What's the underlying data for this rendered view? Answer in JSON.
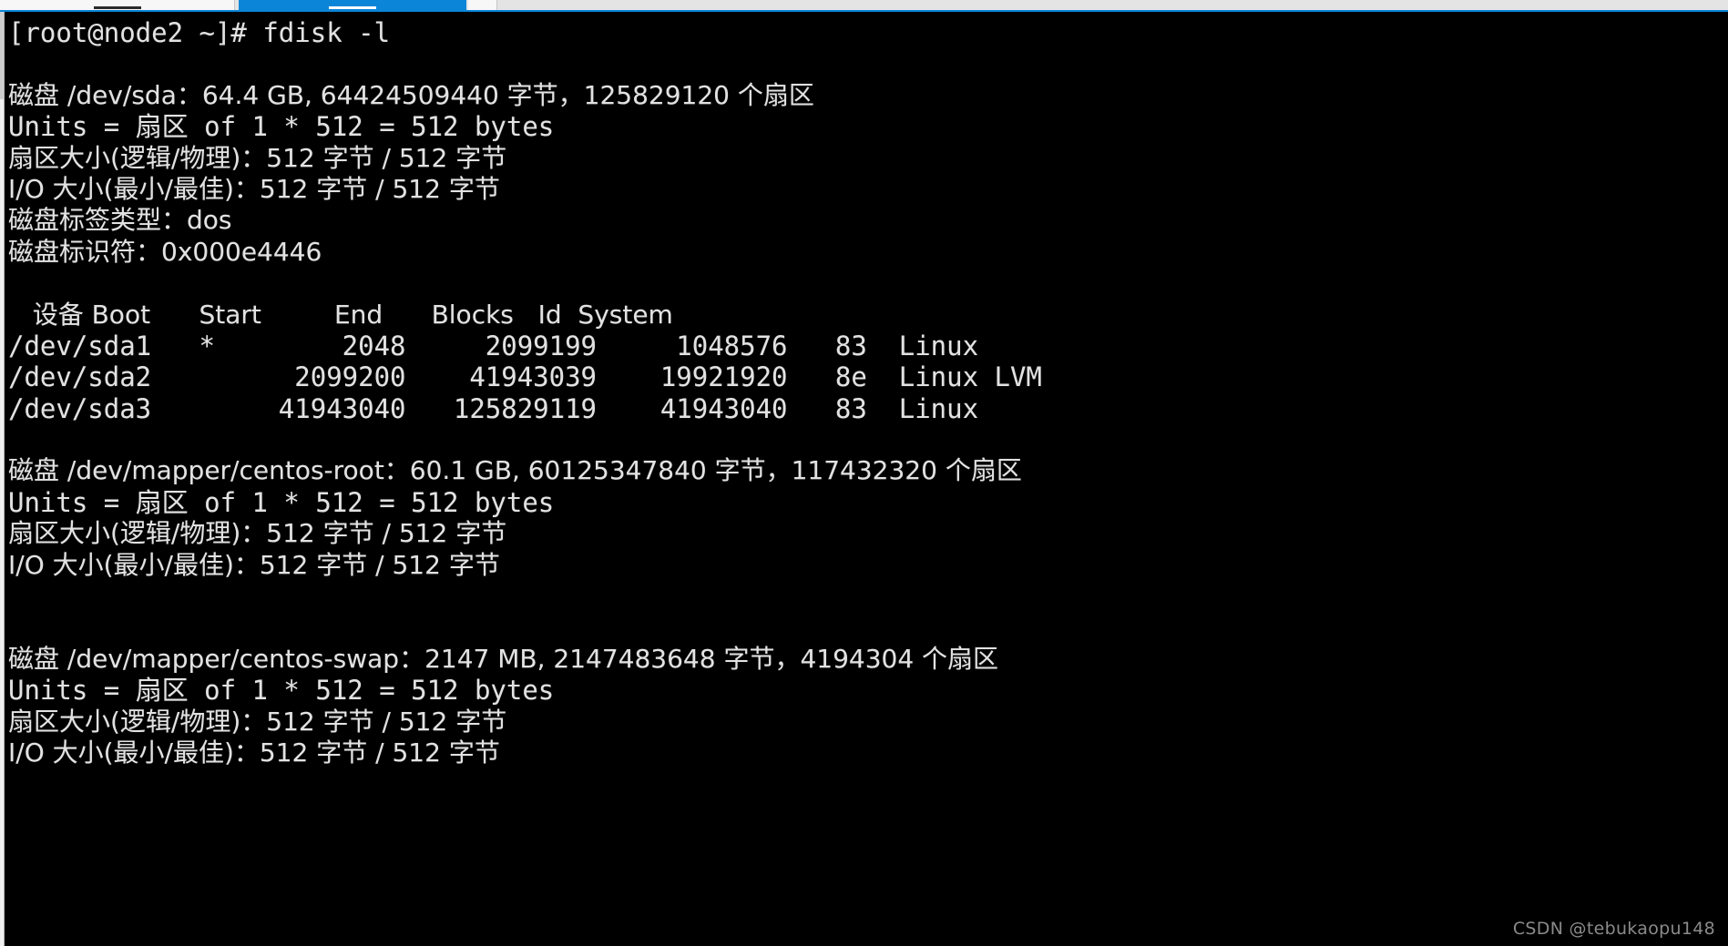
{
  "window": {
    "tabs": [
      {
        "name": "tab-left-inactive",
        "state": "inactive",
        "label": ""
      },
      {
        "name": "tab-active-session",
        "state": "active",
        "label": ""
      },
      {
        "name": "tab-right-inactive",
        "state": "inactive",
        "label": ""
      }
    ],
    "accent_color": "#0a85d8",
    "tabstrip_bg": "#e4e4e4",
    "terminal_bg": "#000000",
    "terminal_fg": "#e2e2e2"
  },
  "terminal": {
    "prompt": "[root@node2 ~]# ",
    "command": "fdisk -l",
    "lines": [
      "[root@node2 ~]# fdisk -l",
      "",
      "磁盘 /dev/sda：64.4 GB, 64424509440 字节，125829120 个扇区",
      "Units = 扇区 of 1 * 512 = 512 bytes",
      "扇区大小(逻辑/物理)：512 字节 / 512 字节",
      "I/O 大小(最小/最佳)：512 字节 / 512 字节",
      "磁盘标签类型：dos",
      "磁盘标识符：0x000e4446",
      "",
      "   设备 Boot      Start         End      Blocks   Id  System",
      "/dev/sda1   *        2048     2099199     1048576   83  Linux",
      "/dev/sda2         2099200    41943039    19921920   8e  Linux LVM",
      "/dev/sda3        41943040   125829119    41943040   83  Linux",
      "",
      "磁盘 /dev/mapper/centos-root：60.1 GB, 60125347840 字节，117432320 个扇区",
      "Units = 扇区 of 1 * 512 = 512 bytes",
      "扇区大小(逻辑/物理)：512 字节 / 512 字节",
      "I/O 大小(最小/最佳)：512 字节 / 512 字节",
      "",
      "",
      "磁盘 /dev/mapper/centos-swap：2147 MB, 2147483648 字节，4194304 个扇区",
      "Units = 扇区 of 1 * 512 = 512 bytes",
      "扇区大小(逻辑/物理)：512 字节 / 512 字节",
      "I/O 大小(最小/最佳)：512 字节 / 512 字节"
    ],
    "disks": [
      {
        "device": "/dev/sda",
        "size_human": "64.4 GB",
        "size_bytes": "64424509440",
        "sectors": "125829120",
        "units": "Units = 扇区 of 1 * 512 = 512 bytes",
        "sector_size": "扇区大小(逻辑/物理)：512 字节 / 512 字节",
        "io_size": "I/O 大小(最小/最佳)：512 字节 / 512 字节",
        "label_type": "dos",
        "identifier": "0x000e4446"
      },
      {
        "device": "/dev/mapper/centos-root",
        "size_human": "60.1 GB",
        "size_bytes": "60125347840",
        "sectors": "117432320",
        "units": "Units = 扇区 of 1 * 512 = 512 bytes",
        "sector_size": "扇区大小(逻辑/物理)：512 字节 / 512 字节",
        "io_size": "I/O 大小(最小/最佳)：512 字节 / 512 字节"
      },
      {
        "device": "/dev/mapper/centos-swap",
        "size_human": "2147 MB",
        "size_bytes": "2147483648",
        "sectors": "4194304",
        "units": "Units = 扇区 of 1 * 512 = 512 bytes",
        "sector_size": "扇区大小(逻辑/物理)：512 字节 / 512 字节",
        "io_size": "I/O 大小(最小/最佳)：512 字节 / 512 字节"
      }
    ],
    "partition_table": {
      "headers": [
        "设备",
        "Boot",
        "Start",
        "End",
        "Blocks",
        "Id",
        "System"
      ],
      "rows": [
        {
          "device": "/dev/sda1",
          "boot": "*",
          "start": "2048",
          "end": "2099199",
          "blocks": "1048576",
          "id": "83",
          "system": "Linux"
        },
        {
          "device": "/dev/sda2",
          "boot": "",
          "start": "2099200",
          "end": "41943039",
          "blocks": "19921920",
          "id": "8e",
          "system": "Linux LVM"
        },
        {
          "device": "/dev/sda3",
          "boot": "",
          "start": "41943040",
          "end": "125829119",
          "blocks": "41943040",
          "id": "83",
          "system": "Linux"
        }
      ]
    }
  },
  "watermark": {
    "text": "CSDN @tebukaopu148"
  }
}
